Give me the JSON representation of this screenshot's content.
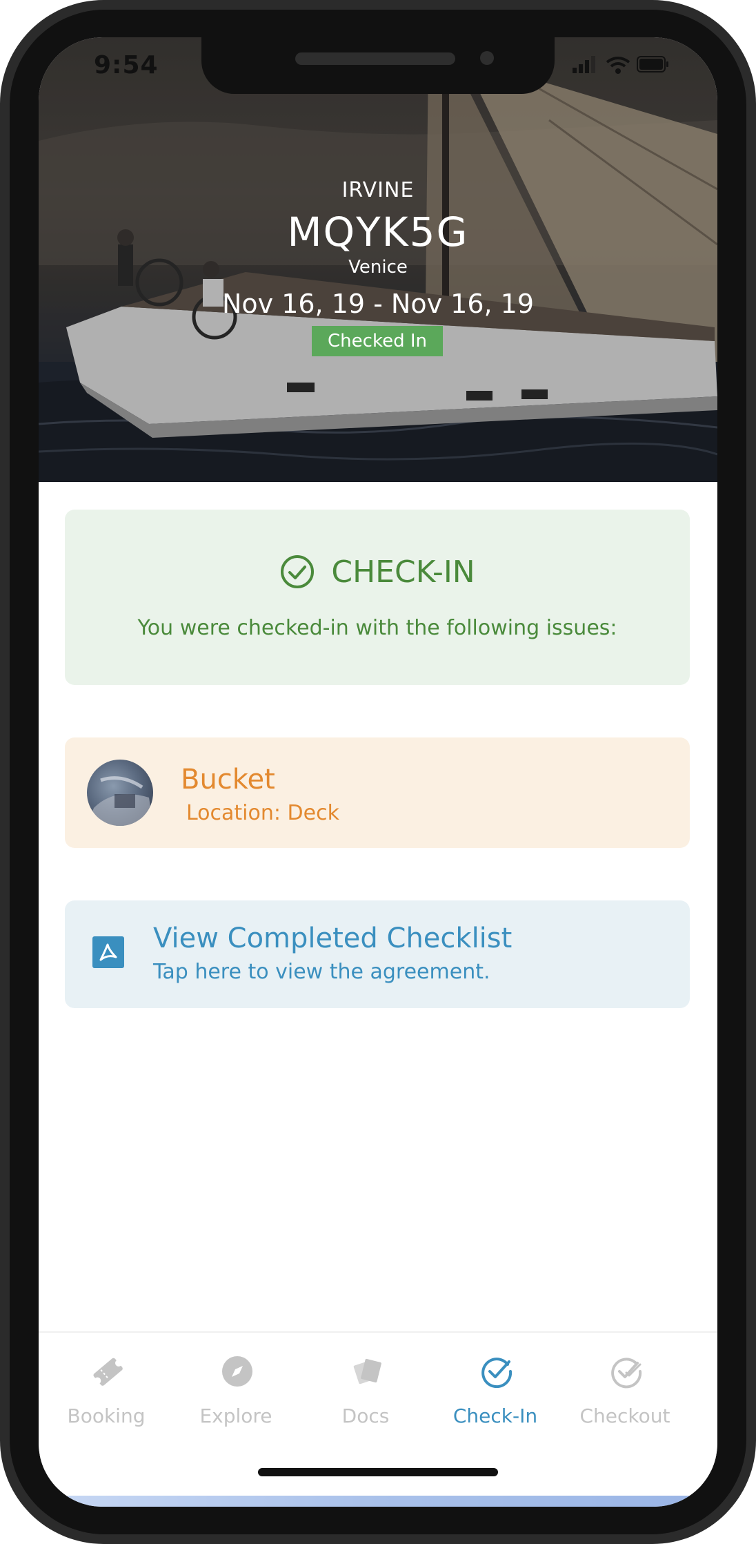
{
  "status_bar": {
    "time": "9:54",
    "icons": [
      "signal-icon",
      "wifi-icon",
      "battery-icon"
    ]
  },
  "booking": {
    "eyebrow": "IRVINE",
    "code": "MQYK5G",
    "location": "Venice",
    "dates": "Nov 16, 19 - Nov 16, 19",
    "status": "Checked In",
    "status_color": "#5ba85a"
  },
  "checkin_card": {
    "title": "CHECK-IN",
    "message": "You were checked-in with the following issues:",
    "color": "#4a8a3b",
    "background": "#eaf3ea",
    "icon": "check-circle-icon"
  },
  "issues": [
    {
      "name": "Bucket",
      "location": "Location: Deck",
      "color": "#e3892f"
    }
  ],
  "document_card": {
    "title": "View Completed Checklist",
    "subtitle": "Tap here to view the agreement.",
    "icon": "pdf-icon",
    "color": "#3a8fbf"
  },
  "tab_bar": {
    "active": "Check-In",
    "active_color": "#3a8fbf",
    "inactive_color": "#c4c4c4",
    "tabs": [
      {
        "label": "Booking",
        "icon": "ticket-icon"
      },
      {
        "label": "Explore",
        "icon": "compass-icon"
      },
      {
        "label": "Docs",
        "icon": "docs-icon"
      },
      {
        "label": "Check-In",
        "icon": "check-circle-icon"
      },
      {
        "label": "Checkout",
        "icon": "double-check-icon"
      }
    ]
  }
}
